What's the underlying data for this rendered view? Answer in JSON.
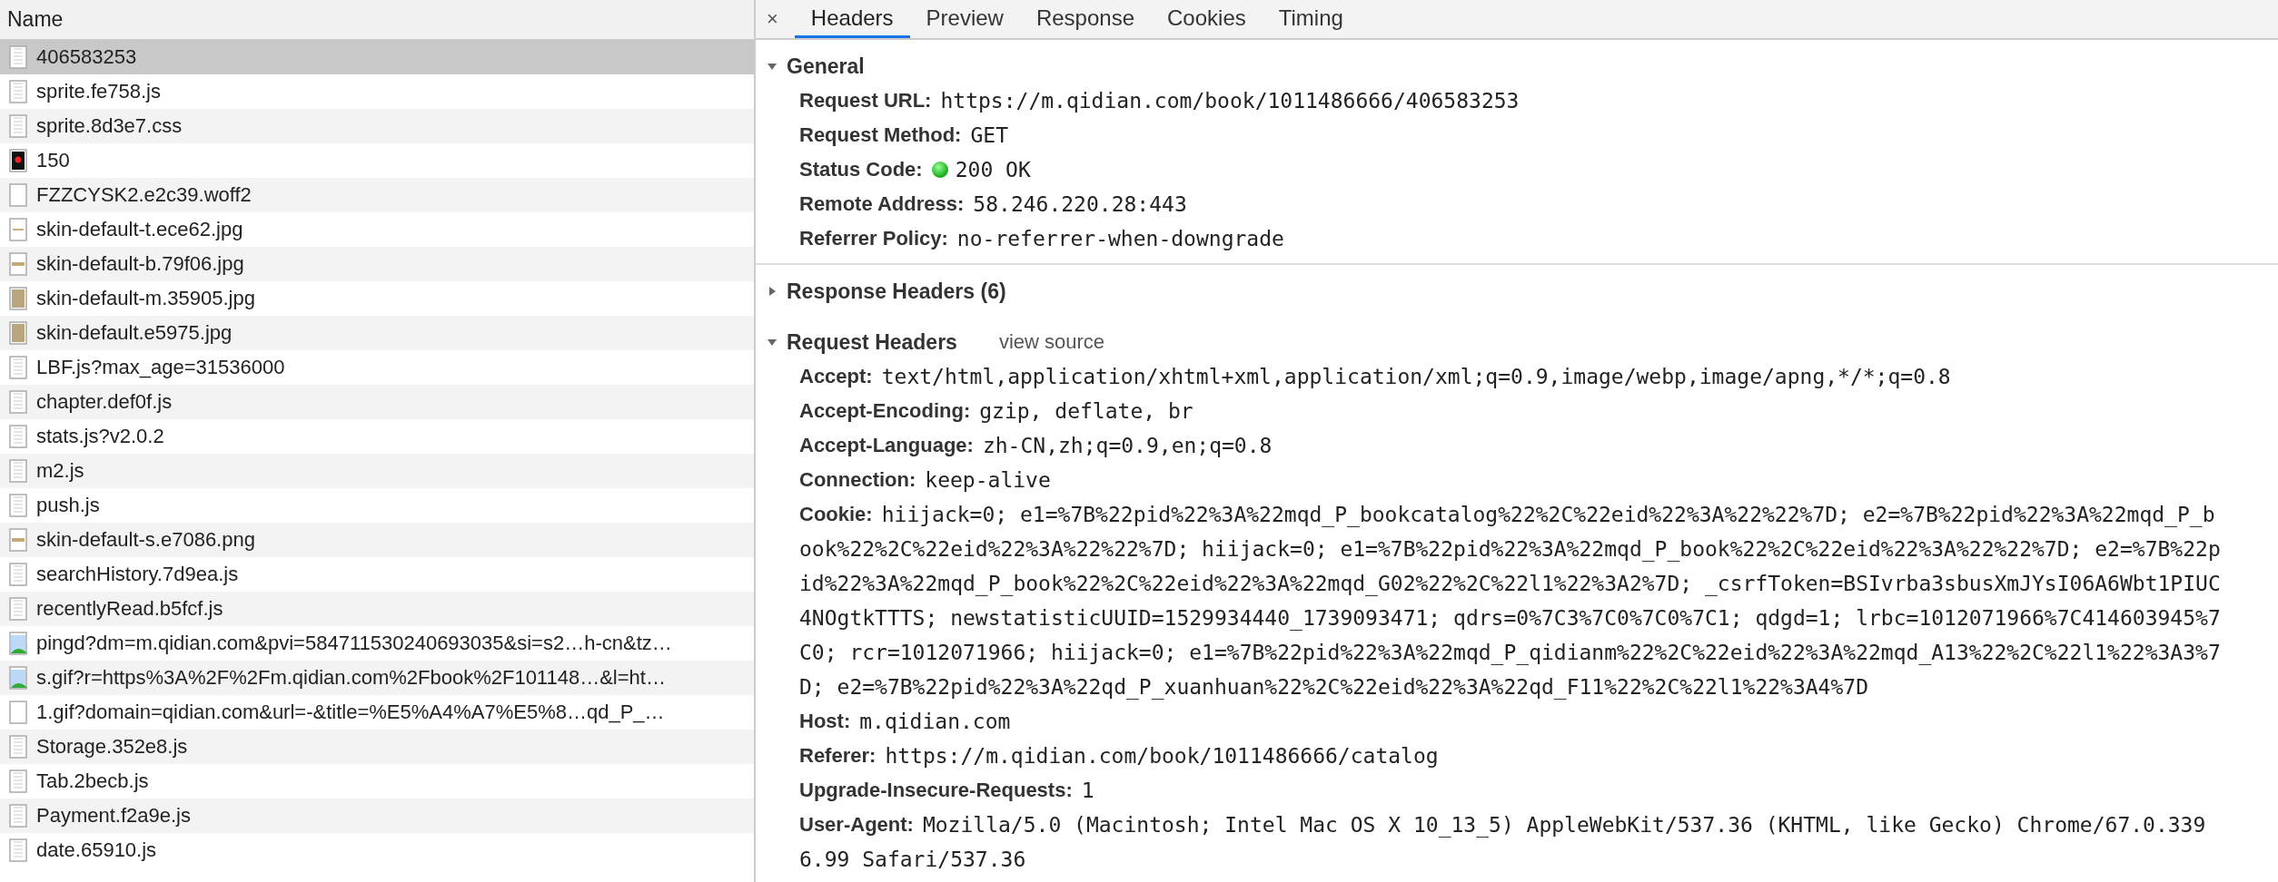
{
  "requests": {
    "column": "Name",
    "rows": [
      {
        "name": "406583253",
        "kind": "doc",
        "selected": true
      },
      {
        "name": "sprite.fe758.js",
        "kind": "doc",
        "selected": false
      },
      {
        "name": "sprite.8d3e7.css",
        "kind": "doc",
        "selected": false
      },
      {
        "name": "150",
        "kind": "thumb",
        "selected": false
      },
      {
        "name": "FZZCYSK2.e2c39.woff2",
        "kind": "blank",
        "selected": false
      },
      {
        "name": "skin-default-t.ece62.jpg",
        "kind": "thin",
        "selected": false
      },
      {
        "name": "skin-default-b.79f06.jpg",
        "kind": "thick",
        "selected": false
      },
      {
        "name": "skin-default-m.35905.jpg",
        "kind": "tan",
        "selected": false
      },
      {
        "name": "skin-default.e5975.jpg",
        "kind": "tan",
        "selected": false
      },
      {
        "name": "LBF.js?max_age=31536000",
        "kind": "doc",
        "selected": false
      },
      {
        "name": "chapter.def0f.js",
        "kind": "doc",
        "selected": false
      },
      {
        "name": "stats.js?v2.0.2",
        "kind": "doc",
        "selected": false
      },
      {
        "name": "m2.js",
        "kind": "doc",
        "selected": false
      },
      {
        "name": "push.js",
        "kind": "doc",
        "selected": false
      },
      {
        "name": "skin-default-s.e7086.png",
        "kind": "thick",
        "selected": false
      },
      {
        "name": "searchHistory.7d9ea.js",
        "kind": "doc",
        "selected": false
      },
      {
        "name": "recentlyRead.b5fcf.js",
        "kind": "doc",
        "selected": false
      },
      {
        "name": "pingd?dm=m.qidian.com&pvi=584711530240693035&si=s2…h-cn&tz…",
        "kind": "image",
        "selected": false
      },
      {
        "name": "s.gif?r=https%3A%2F%2Fm.qidian.com%2Fbook%2F101148…&l=ht…",
        "kind": "image",
        "selected": false
      },
      {
        "name": "1.gif?domain=qidian.com&url=-&title=%E5%A4%A7%E5%8…qd_P_…",
        "kind": "blank",
        "selected": false
      },
      {
        "name": "Storage.352e8.js",
        "kind": "doc",
        "selected": false
      },
      {
        "name": "Tab.2becb.js",
        "kind": "doc",
        "selected": false
      },
      {
        "name": "Payment.f2a9e.js",
        "kind": "doc",
        "selected": false
      },
      {
        "name": "date.65910.js",
        "kind": "doc",
        "selected": false
      }
    ]
  },
  "detail": {
    "close": "×",
    "tabs": [
      {
        "label": "Headers",
        "selected": true
      },
      {
        "label": "Preview",
        "selected": false
      },
      {
        "label": "Response",
        "selected": false
      },
      {
        "label": "Cookies",
        "selected": false
      },
      {
        "label": "Timing",
        "selected": false
      }
    ],
    "sections": [
      {
        "title": "General",
        "expanded": true,
        "fields": [
          {
            "name": "Request URL:",
            "value": "https://m.qidian.com/book/1011486666/406583253"
          },
          {
            "name": "Request Method:",
            "value": "GET"
          },
          {
            "name": "Status Code:",
            "value": "200 OK",
            "kind": "status"
          },
          {
            "name": "Remote Address:",
            "value": "58.246.220.28:443"
          },
          {
            "name": "Referrer Policy:",
            "value": "no-referrer-when-downgrade"
          }
        ]
      },
      {
        "title": "Response Headers (6)",
        "expanded": false
      },
      {
        "title": "Request Headers",
        "link": "view source",
        "expanded": true,
        "fields": [
          {
            "name": "Accept:",
            "value": "text/html,application/xhtml+xml,application/xml;q=0.9,image/webp,image/apng,*/*;q=0.8"
          },
          {
            "name": "Accept-Encoding:",
            "value": "gzip, deflate, br"
          },
          {
            "name": "Accept-Language:",
            "value": "zh-CN,zh;q=0.9,en;q=0.8"
          },
          {
            "name": "Connection:",
            "value": "keep-alive"
          },
          {
            "name": "Cookie:",
            "value": "hiijack=0; e1=%7B%22pid%22%3A%22mqd_P_bookcatalog%22%2C%22eid%22%3A%22%22%7D; e2=%7B%22pid%22%3A%22mqd_P_b",
            "more": [
              "ook%22%2C%22eid%22%3A%22%22%7D; hiijack=0; e1=%7B%22pid%22%3A%22mqd_P_book%22%2C%22eid%22%3A%22%22%7D; e2=%7B%22p",
              "id%22%3A%22mqd_P_book%22%2C%22eid%22%3A%22mqd_G02%22%2C%22l1%22%3A2%7D; _csrfToken=BSIvrba3sbusXmJYsI06A6Wbt1PIUC",
              "4NOgtkTTTS; newstatisticUUID=1529934440_1739093471; qdrs=0%7C3%7C0%7C0%7C1; qdgd=1; lrbc=1012071966%7C414603945%7",
              "C0; rcr=1012071966; hiijack=0; e1=%7B%22pid%22%3A%22mqd_P_qidianm%22%2C%22eid%22%3A%22mqd_A13%22%2C%22l1%22%3A3%7",
              "D; e2=%7B%22pid%22%3A%22qd_P_xuanhuan%22%2C%22eid%22%3A%22qd_F11%22%2C%22l1%22%3A4%7D"
            ]
          },
          {
            "name": "Host:",
            "value": "m.qidian.com"
          },
          {
            "name": "Referer:",
            "value": "https://m.qidian.com/book/1011486666/catalog"
          },
          {
            "name": "Upgrade-Insecure-Requests:",
            "value": "1"
          },
          {
            "name": "User-Agent:",
            "value": "Mozilla/5.0 (Macintosh; Intel Mac OS X 10_13_5) AppleWebKit/537.36 (KHTML, like Gecko) Chrome/67.0.339",
            "more": [
              "6.99 Safari/537.36"
            ]
          }
        ]
      }
    ]
  }
}
